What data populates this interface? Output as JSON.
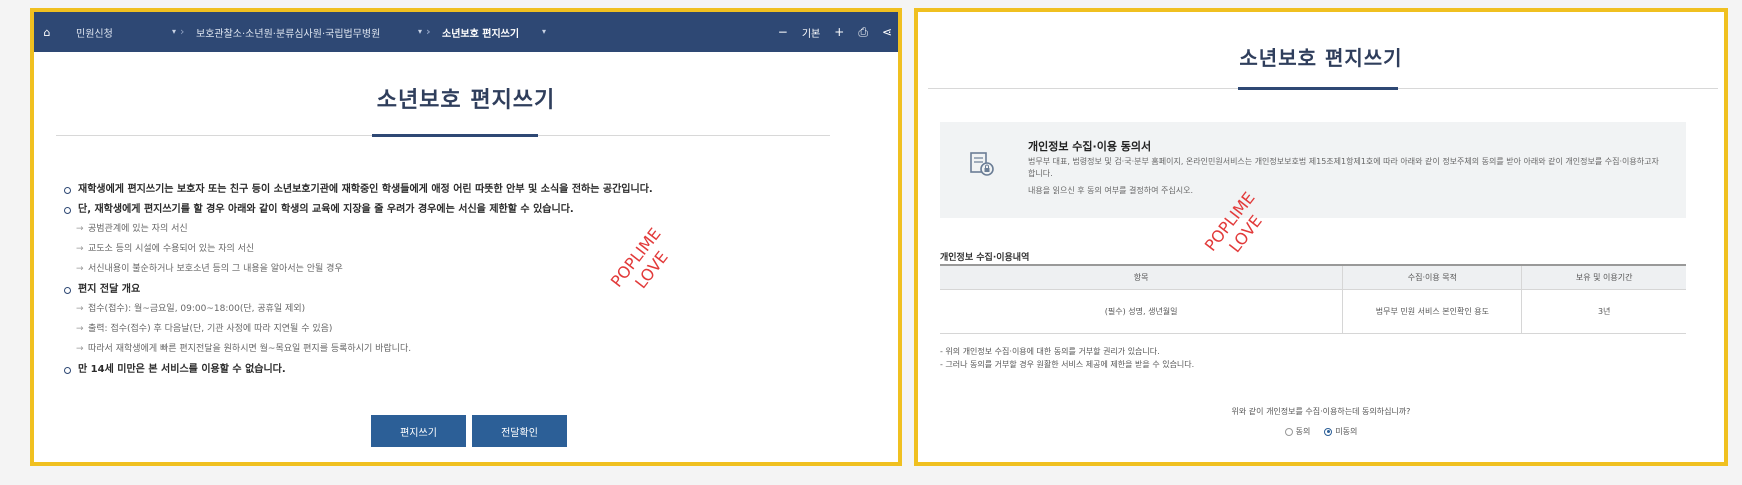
{
  "nav": {
    "breadcrumbs": [
      "민원신청",
      "보호관찰소·소년원·분류심사원·국립법무병원",
      "소년보호 편지쓰기"
    ],
    "font_size_label": "기본"
  },
  "left": {
    "title": "소년보호 편지쓰기",
    "notices": [
      {
        "type": "bullet",
        "text": "재학생에게 편지쓰기는 보호자 또는 친구 등이 소년보호기관에 재학중인 학생들에게 애정 어린 따뜻한 안부 및 소식을 전하는 공간입니다."
      },
      {
        "type": "bullet",
        "text": "단, 재학생에게 편지쓰기를 할 경우 아래와 같이 학생의 교육에 지장을 줄 우려가 경우에는 서신을 제한할 수 있습니다."
      },
      {
        "type": "sub",
        "text": "공범관계에 있는 자의 서신"
      },
      {
        "type": "sub",
        "text": "교도소 등의 시설에 수용되어 있는 자의 서신"
      },
      {
        "type": "sub",
        "text": "서신내용이 불순하거나 보호소년 등의 그 내용을 알아서는 안될 경우"
      },
      {
        "type": "bullet",
        "text": "편지 전달 개요"
      },
      {
        "type": "sub",
        "text": "접수(접수): 월~금요일, 09:00~18:00(단, 공휴일 제외)"
      },
      {
        "type": "sub",
        "text": "출력: 접수(접수) 후 다음날(단, 기관 사정에 따라 지연될 수 있음)"
      },
      {
        "type": "sub",
        "text": "따라서 재학생에게 빠른 편지전달을 원하시면 월~목요일 편지를 등록하시기 바랍니다."
      },
      {
        "type": "bullet",
        "text": "만 14세 미만은 본 서비스를 이용할 수 없습니다."
      }
    ],
    "buttons": [
      "편지쓰기",
      "전달확인"
    ],
    "watermark": [
      "POPLIME",
      "LOVE"
    ]
  },
  "right": {
    "title": "소년보호 편지쓰기",
    "consent": {
      "title": "개인정보 수집·이용 동의서",
      "body": "법무부 대표, 법령정보 및 검·국·분부 홈페이지, 온라인민원서비스는 개인정보보호법 제15조제1항제1호에 따라 아래와 같이 정보주체의 동의를 받아 아래와 같이 개인정보를 수집·이용하고자 합니다.",
      "body2": "내용을 읽으신 후 동의 여부를 결정하여 주십시오."
    },
    "section_label": "개인정보 수집·이용내역",
    "table": {
      "headers": [
        "항목",
        "수집·이용 목적",
        "보유 및 이용기간"
      ],
      "row": [
        "(필수) 성명, 생년월일",
        "법무부 민원 서비스 본인확인 용도",
        "3년"
      ]
    },
    "notes": [
      "- 위의 개인정보 수집·이용에 대한 동의를 거부할 권리가 있습니다.",
      "- 그러나 동의를 거부할 경우 원활한 서비스 제공에 제한을 받을 수 있습니다."
    ],
    "agree_question": "위와 같이 개인정보를 수집·이용하는데 동의하십니까?",
    "agree_options": [
      "동의",
      "미동의"
    ],
    "selected_option": "미동의",
    "watermark": [
      "POPLIME",
      "LOVE"
    ]
  },
  "colors": {
    "nav_bg": "#2e4874",
    "button": "#2c5f97",
    "frame": "#f0c020",
    "watermark": "#e23a3a"
  }
}
